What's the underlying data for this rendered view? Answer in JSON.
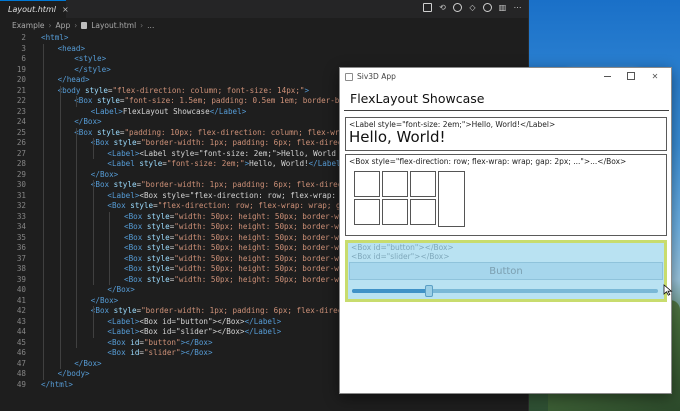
{
  "editor": {
    "tab_label": "Layout.html",
    "tab_close": "×",
    "breadcrumb": [
      "Example",
      "App",
      "Layout.html",
      "..."
    ],
    "lines": [
      {
        "n": "2",
        "indent": 0,
        "tokens": [
          [
            "t",
            "<html>"
          ]
        ]
      },
      {
        "n": "3",
        "indent": 1,
        "tokens": [
          [
            "t",
            "<head>"
          ]
        ]
      },
      {
        "n": "6",
        "indent": 2,
        "tokens": [
          [
            "t",
            "<style>"
          ]
        ]
      },
      {
        "n": "19",
        "indent": 2,
        "tokens": [
          [
            "t",
            "</style>"
          ]
        ]
      },
      {
        "n": "20",
        "indent": 1,
        "tokens": [
          [
            "t",
            "</head>"
          ]
        ]
      },
      {
        "n": "21",
        "indent": 1,
        "tokens": [
          [
            "t",
            "<body "
          ],
          [
            "a",
            "style"
          ],
          [
            "tx",
            "="
          ],
          [
            "s",
            "\"flex-direction: column; font-size: 14px;\""
          ],
          [
            "t",
            ">"
          ]
        ]
      },
      {
        "n": "22",
        "indent": 2,
        "tokens": [
          [
            "t",
            "<Box "
          ],
          [
            "a",
            "style"
          ],
          [
            "tx",
            "="
          ],
          [
            "s",
            "\"font-size: 1.5em; padding: 0.5em 1em; border-bottom-"
          ]
        ]
      },
      {
        "n": "23",
        "indent": 3,
        "tokens": [
          [
            "t",
            "<Label>"
          ],
          [
            "tx",
            "FlexLayout Showcase"
          ],
          [
            "t",
            "</Label>"
          ]
        ]
      },
      {
        "n": "24",
        "indent": 2,
        "tokens": [
          [
            "t",
            "</Box>"
          ]
        ]
      },
      {
        "n": "25",
        "indent": 2,
        "tokens": [
          [
            "t",
            "<Box "
          ],
          [
            "a",
            "style"
          ],
          [
            "tx",
            "="
          ],
          [
            "s",
            "\"padding: 10px; flex-direction: column; flex-wrap: wr"
          ]
        ]
      },
      {
        "n": "26",
        "indent": 3,
        "tokens": [
          [
            "t",
            "<Box "
          ],
          [
            "a",
            "style"
          ],
          [
            "tx",
            "="
          ],
          [
            "s",
            "\"border-width: 1px; padding: 6px; flex-direction:"
          ]
        ]
      },
      {
        "n": "27",
        "indent": 4,
        "tokens": [
          [
            "t",
            "<Label>"
          ],
          [
            "tx",
            "&lt;Label style=\"font-size: 2em;\"&gt;Hello, World"
          ]
        ]
      },
      {
        "n": "28",
        "indent": 4,
        "tokens": [
          [
            "t",
            "<Label "
          ],
          [
            "a",
            "style"
          ],
          [
            "tx",
            "="
          ],
          [
            "s",
            "\"font-size: 2em;\""
          ],
          [
            "t",
            ">"
          ],
          [
            "tx",
            "Hello, World!"
          ],
          [
            "t",
            "</Label>"
          ]
        ]
      },
      {
        "n": "29",
        "indent": 3,
        "tokens": [
          [
            "t",
            "</Box>"
          ]
        ]
      },
      {
        "n": "30",
        "indent": 3,
        "tokens": [
          [
            "t",
            "<Box "
          ],
          [
            "a",
            "style"
          ],
          [
            "tx",
            "="
          ],
          [
            "s",
            "\"border-width: 1px; padding: 6px; flex-direction:"
          ]
        ]
      },
      {
        "n": "31",
        "indent": 4,
        "tokens": [
          [
            "t",
            "<Label>"
          ],
          [
            "tx",
            "&lt;Box style=\"flex-direction: row; flex-wrap: wr"
          ]
        ]
      },
      {
        "n": "32",
        "indent": 4,
        "tokens": [
          [
            "t",
            "<Box "
          ],
          [
            "a",
            "style"
          ],
          [
            "tx",
            "="
          ],
          [
            "s",
            "\"flex-direction: row; flex-wrap: wrap; gap: 2"
          ]
        ]
      },
      {
        "n": "33",
        "indent": 5,
        "tokens": [
          [
            "t",
            "<Box "
          ],
          [
            "a",
            "style"
          ],
          [
            "tx",
            "="
          ],
          [
            "s",
            "\"width: 50px; height: 50px; border-width:"
          ]
        ]
      },
      {
        "n": "34",
        "indent": 5,
        "tokens": [
          [
            "t",
            "<Box "
          ],
          [
            "a",
            "style"
          ],
          [
            "tx",
            "="
          ],
          [
            "s",
            "\"width: 50px; height: 50px; border-width:"
          ]
        ]
      },
      {
        "n": "35",
        "indent": 5,
        "tokens": [
          [
            "t",
            "<Box "
          ],
          [
            "a",
            "style"
          ],
          [
            "tx",
            "="
          ],
          [
            "s",
            "\"width: 50px; height: 50px; border-width:"
          ]
        ]
      },
      {
        "n": "36",
        "indent": 5,
        "tokens": [
          [
            "t",
            "<Box "
          ],
          [
            "a",
            "style"
          ],
          [
            "tx",
            "="
          ],
          [
            "s",
            "\"width: 50px; height: 50px; border-width:"
          ]
        ]
      },
      {
        "n": "37",
        "indent": 5,
        "tokens": [
          [
            "t",
            "<Box "
          ],
          [
            "a",
            "style"
          ],
          [
            "tx",
            "="
          ],
          [
            "s",
            "\"width: 50px; height: 50px; border-width:"
          ]
        ]
      },
      {
        "n": "38",
        "indent": 5,
        "tokens": [
          [
            "t",
            "<Box "
          ],
          [
            "a",
            "style"
          ],
          [
            "tx",
            "="
          ],
          [
            "s",
            "\"width: 50px; height: 50px; border-width:"
          ]
        ]
      },
      {
        "n": "39",
        "indent": 5,
        "tokens": [
          [
            "t",
            "<Box "
          ],
          [
            "a",
            "style"
          ],
          [
            "tx",
            "="
          ],
          [
            "s",
            "\"width: 50px; height: 50px; border-width:"
          ]
        ]
      },
      {
        "n": "40",
        "indent": 4,
        "tokens": [
          [
            "t",
            "</Box>"
          ]
        ]
      },
      {
        "n": "41",
        "indent": 3,
        "tokens": [
          [
            "t",
            "</Box>"
          ]
        ]
      },
      {
        "n": "42",
        "indent": 3,
        "tokens": [
          [
            "t",
            "<Box "
          ],
          [
            "a",
            "style"
          ],
          [
            "tx",
            "="
          ],
          [
            "s",
            "\"border-width: 1px; padding: 6px; flex-direction:"
          ]
        ]
      },
      {
        "n": "43",
        "indent": 4,
        "tokens": [
          [
            "t",
            "<Label>"
          ],
          [
            "tx",
            "&lt;Box id=\"button\"&gt;&lt;/Box&gt;"
          ],
          [
            "t",
            "</Label>"
          ]
        ]
      },
      {
        "n": "44",
        "indent": 4,
        "tokens": [
          [
            "t",
            "<Label>"
          ],
          [
            "tx",
            "&lt;Box id=\"slider\"&gt;&lt;/Box&gt;"
          ],
          [
            "t",
            "</Label>"
          ]
        ]
      },
      {
        "n": "45",
        "indent": 4,
        "tokens": [
          [
            "t",
            "<Box "
          ],
          [
            "a",
            "id"
          ],
          [
            "tx",
            "="
          ],
          [
            "s",
            "\"button\""
          ],
          [
            "t",
            "></Box>"
          ]
        ]
      },
      {
        "n": "46",
        "indent": 4,
        "tokens": [
          [
            "t",
            "<Box "
          ],
          [
            "a",
            "id"
          ],
          [
            "tx",
            "="
          ],
          [
            "s",
            "\"slider\""
          ],
          [
            "t",
            "></Box>"
          ]
        ]
      },
      {
        "n": "47",
        "indent": 2,
        "tokens": [
          [
            "t",
            "</Box>"
          ]
        ]
      },
      {
        "n": "48",
        "indent": 1,
        "tokens": [
          [
            "t",
            "</body>"
          ]
        ]
      },
      {
        "n": "49",
        "indent": 0,
        "tokens": [
          [
            "t",
            "</html>"
          ]
        ]
      }
    ]
  },
  "app": {
    "window_title": "Siv3D App",
    "close_glyph": "✕",
    "heading": "FlexLayout Showcase",
    "panel1_code": "<Label style=\"font-size: 2em;\">Hello, World!</Label>",
    "panel1_hello": "Hello, World!",
    "panel2_code": "<Box style=\"flex-direction: row; flex-wrap: wrap; gap: 2px; ...\">...</Box>",
    "panel2_box_count": 7,
    "panel3_line1": "<Box id=\"button\"></Box>",
    "panel3_line2": "<Box id=\"slider\"></Box>",
    "button_label": "Button",
    "slider_value": 0.25
  },
  "colors": {
    "tag": "#569cd6",
    "attr": "#9cdcfe",
    "string": "#ce9178",
    "panel3_bg": "#b9e2f2",
    "panel3_border": "#c8dc6e"
  }
}
